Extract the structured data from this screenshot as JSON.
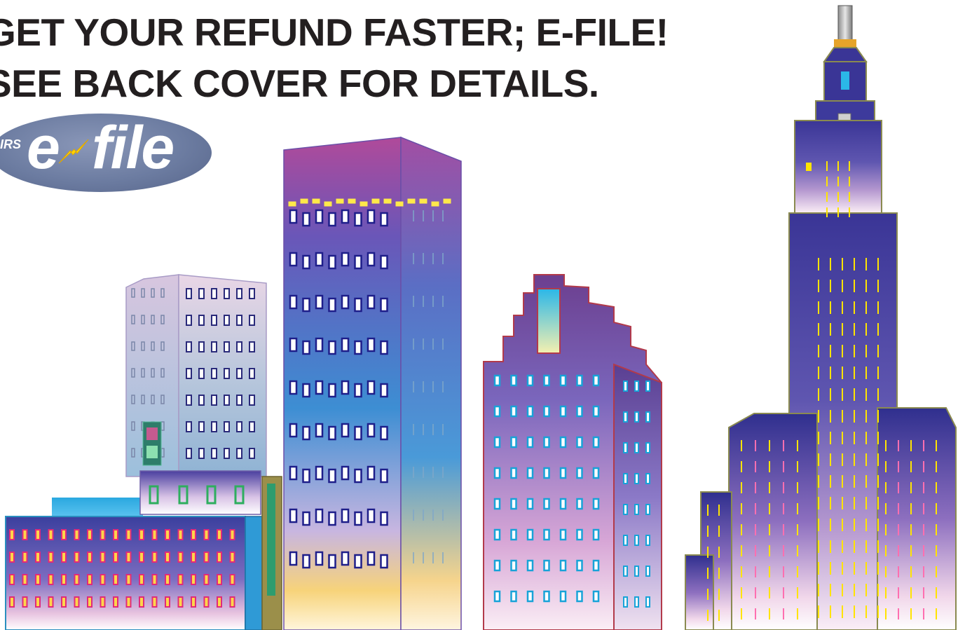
{
  "headline": {
    "line1": "GET YOUR REFUND FASTER; E-FILE!",
    "line2": "SEE BACK COVER FOR DETAILS."
  },
  "logo": {
    "prefix": "IRS",
    "e": "e",
    "word": "file",
    "icon": "lightning-bolt-icon"
  },
  "colors": {
    "headline_text": "#231f20",
    "logo_oval": "#6c7ca1",
    "logo_bolt": "#ffd400",
    "sky_purple": "#4b3a9c",
    "sky_blue": "#2f8fd1",
    "sunset_pink": "#f3c6dc",
    "window_yellow": "#ffe400",
    "tower_outline": "#8a8a50"
  }
}
